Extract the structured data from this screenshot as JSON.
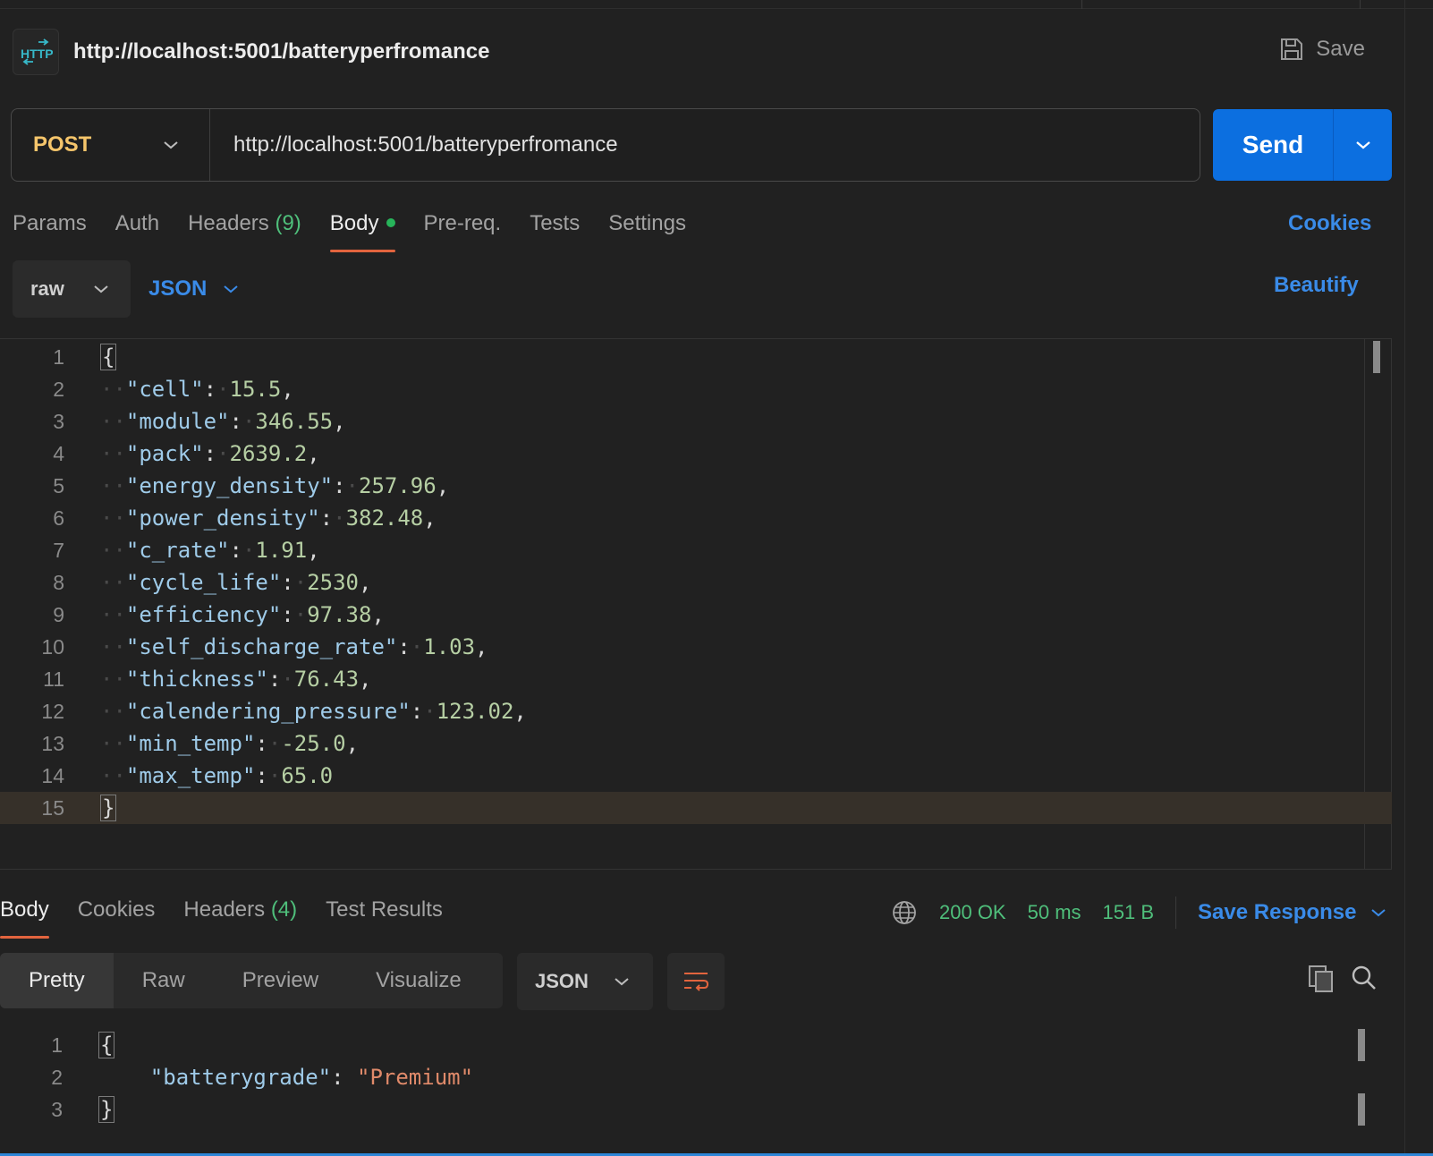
{
  "request": {
    "title": "http://localhost:5001/batteryperfromance",
    "save_label": "Save",
    "method": "POST",
    "url": "http://localhost:5001/batteryperfromance",
    "send_label": "Send"
  },
  "request_tabs": [
    {
      "label": "Params"
    },
    {
      "label": "Auth"
    },
    {
      "label": "Headers",
      "count": "(9)"
    },
    {
      "label": "Body",
      "active": true
    },
    {
      "label": "Pre-req."
    },
    {
      "label": "Tests"
    },
    {
      "label": "Settings"
    }
  ],
  "cookies_label": "Cookies",
  "body_options": {
    "mode": "raw",
    "language": "JSON",
    "beautify_label": "Beautify"
  },
  "request_body": {
    "line_numbers": [
      "1",
      "2",
      "3",
      "4",
      "5",
      "6",
      "7",
      "8",
      "9",
      "10",
      "11",
      "12",
      "13",
      "14",
      "15"
    ],
    "open_brace": "{",
    "close_brace": "}",
    "fields": [
      {
        "key": "\"cell\"",
        "value": "15.5",
        "sep": ","
      },
      {
        "key": "\"module\"",
        "value": "346.55",
        "sep": ","
      },
      {
        "key": "\"pack\"",
        "value": "2639.2",
        "sep": ","
      },
      {
        "key": "\"energy_density\"",
        "value": "257.96",
        "sep": ","
      },
      {
        "key": "\"power_density\"",
        "value": "382.48",
        "sep": ","
      },
      {
        "key": "\"c_rate\"",
        "value": "1.91",
        "sep": ","
      },
      {
        "key": "\"cycle_life\"",
        "value": "2530",
        "sep": ","
      },
      {
        "key": "\"efficiency\"",
        "value": "97.38",
        "sep": ","
      },
      {
        "key": "\"self_discharge_rate\"",
        "value": "1.03",
        "sep": ","
      },
      {
        "key": "\"thickness\"",
        "value": "76.43",
        "sep": ","
      },
      {
        "key": "\"calendering_pressure\"",
        "value": "123.02",
        "sep": ","
      },
      {
        "key": "\"min_temp\"",
        "value": "-25.0",
        "sep": ","
      },
      {
        "key": "\"max_temp\"",
        "value": "65.0",
        "sep": ""
      }
    ]
  },
  "response_tabs": [
    {
      "label": "Body",
      "active": true
    },
    {
      "label": "Cookies"
    },
    {
      "label": "Headers",
      "count": "(4)"
    },
    {
      "label": "Test Results"
    }
  ],
  "response_meta": {
    "status": "200 OK",
    "time": "50 ms",
    "size": "151 B",
    "save_response_label": "Save Response"
  },
  "response_views": [
    "Pretty",
    "Raw",
    "Preview",
    "Visualize"
  ],
  "response_language": "JSON",
  "response_body": {
    "line_numbers": [
      "1",
      "2",
      "3"
    ],
    "open_brace": "{",
    "close_brace": "}",
    "key": "\"batterygrade\"",
    "value": "\"Premium\""
  },
  "colors": {
    "accent_blue": "#0c6fe0",
    "method_post": "#f5c56b",
    "status_green": "#4fbf7b",
    "active_tab_underline": "#e2643e"
  }
}
